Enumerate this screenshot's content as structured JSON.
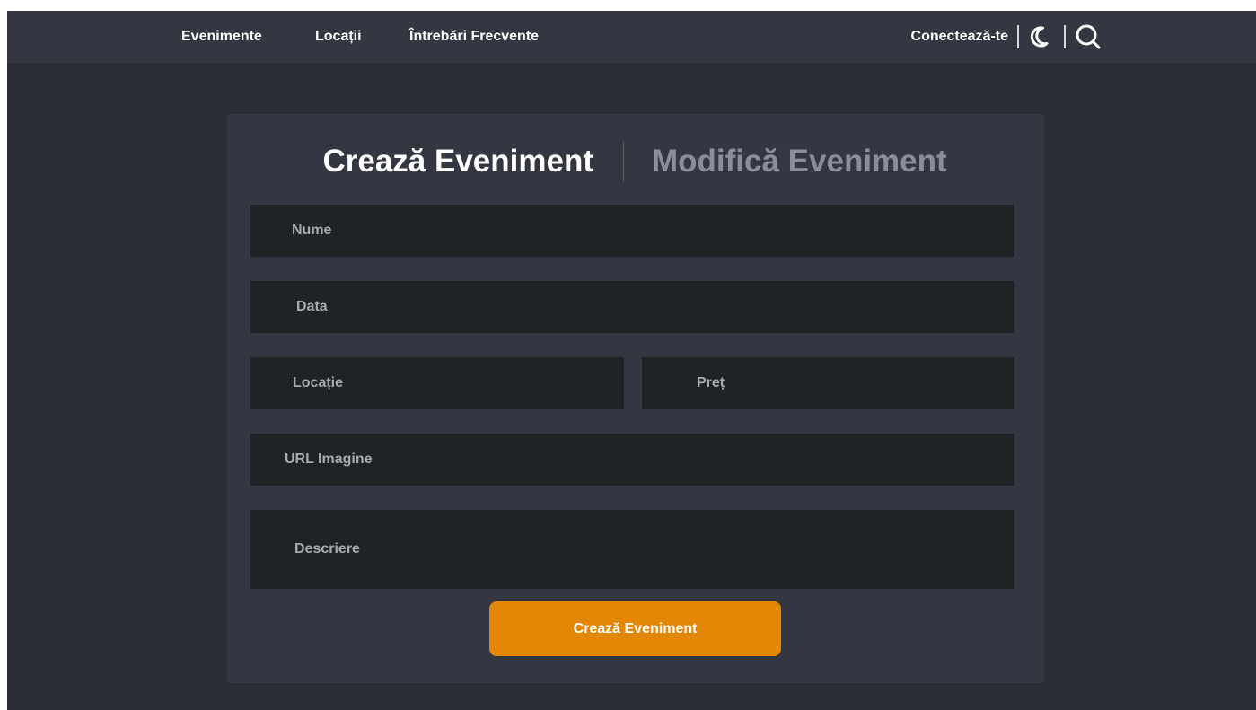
{
  "nav": {
    "links": [
      "Evenimente",
      "Locații",
      "Întrebări Frecvente"
    ],
    "login_label": "Conectează-te",
    "theme_icon": "moon-icon",
    "search_icon": "search-icon"
  },
  "tabs": {
    "active": "Crează Eveniment",
    "inactive": "Modifică Eveniment"
  },
  "form": {
    "name_placeholder": "Nume",
    "date_placeholder": "Data",
    "location_placeholder": "Locație",
    "price_placeholder": "Preț",
    "image_url_placeholder": "URL Imagine",
    "description_placeholder": "Descriere",
    "submit_label": "Crează Eveniment"
  },
  "colors": {
    "page_bg": "#2a2d35",
    "nav_bg": "#343741",
    "card_bg": "#343741",
    "field_bg": "#202326",
    "accent": "#e58706"
  }
}
